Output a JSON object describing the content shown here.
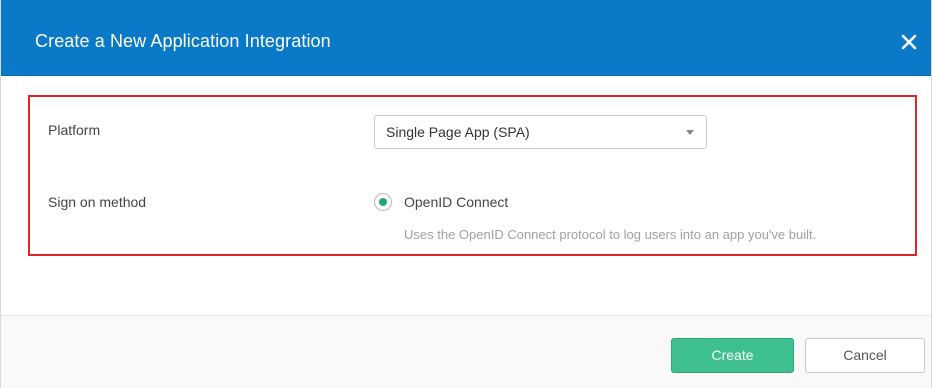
{
  "dialog": {
    "title": "Create a New Application Integration",
    "close_icon": "close-icon"
  },
  "form": {
    "platform": {
      "label": "Platform",
      "selected": "Single Page App (SPA)"
    },
    "sign_on": {
      "label": "Sign on method",
      "option_label": "OpenID Connect",
      "option_description": "Uses the OpenID Connect protocol to log users into an app you've built.",
      "selected": true
    }
  },
  "footer": {
    "create_label": "Create",
    "cancel_label": "Cancel"
  },
  "colors": {
    "header_bg": "#0a7ac8",
    "highlight_border": "#e0252b",
    "accent_green": "#3dbf8f",
    "radio_dot": "#1ea97c"
  }
}
